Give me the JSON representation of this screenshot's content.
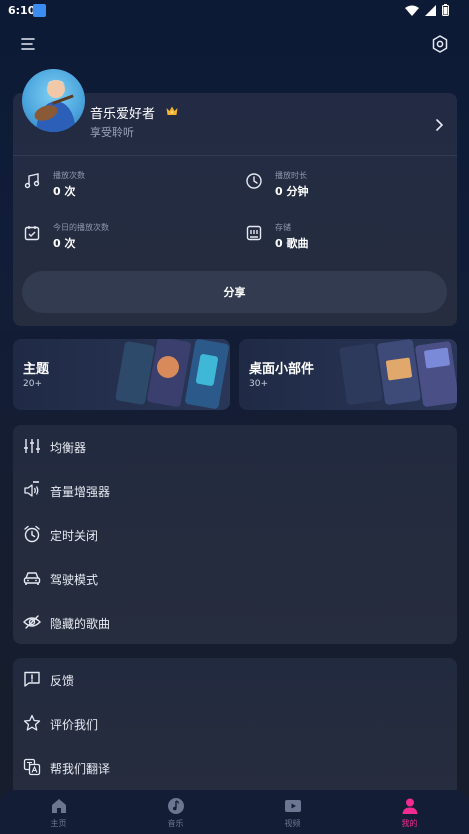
{
  "status_bar": {
    "time": "6:10"
  },
  "profile": {
    "name": "音乐爱好者",
    "subtitle": "享受聆听"
  },
  "stats": [
    {
      "label": "播放次数",
      "value": "0 次",
      "icon": "music-note-icon"
    },
    {
      "label": "播放时长",
      "value": "0 分钟",
      "icon": "clock-icon"
    },
    {
      "label": "今日的播放次数",
      "value": "0 次",
      "icon": "calendar-check-icon"
    },
    {
      "label": "存储",
      "value": "0 歌曲",
      "icon": "storage-icon"
    }
  ],
  "share_label": "分享",
  "promos": [
    {
      "title": "主题",
      "count": "20+"
    },
    {
      "title": "桌面小部件",
      "count": "30+"
    }
  ],
  "menu_group_1": [
    {
      "label": "均衡器",
      "icon": "equalizer-icon"
    },
    {
      "label": "音量增强器",
      "icon": "volume-booster-icon"
    },
    {
      "label": "定时关闭",
      "icon": "alarm-icon"
    },
    {
      "label": "驾驶模式",
      "icon": "car-icon"
    },
    {
      "label": "隐藏的歌曲",
      "icon": "hidden-eye-icon"
    }
  ],
  "menu_group_2": [
    {
      "label": "反馈",
      "icon": "feedback-icon"
    },
    {
      "label": "评价我们",
      "icon": "star-icon"
    },
    {
      "label": "帮我们翻译",
      "icon": "translate-icon"
    }
  ],
  "bottom_nav": [
    {
      "label": "主页",
      "icon": "home-icon",
      "active": false
    },
    {
      "label": "音乐",
      "icon": "music-disc-icon",
      "active": false
    },
    {
      "label": "视频",
      "icon": "video-icon",
      "active": false
    },
    {
      "label": "我的",
      "icon": "person-icon",
      "active": true
    }
  ],
  "colors": {
    "accent": "#f12b8f",
    "background": "#111d38",
    "card": "#242c40"
  }
}
